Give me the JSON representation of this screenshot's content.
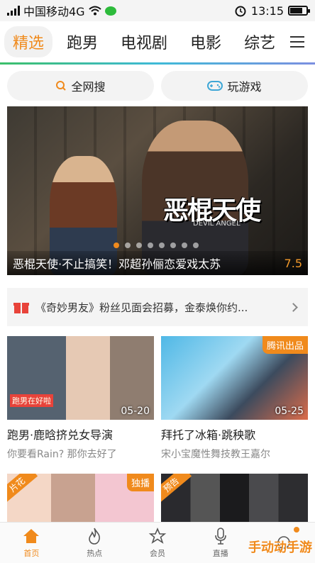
{
  "status_bar": {
    "carrier": "中国移动4G",
    "time": "13:15"
  },
  "tabs": [
    {
      "label": "精选",
      "active": true
    },
    {
      "label": "跑男",
      "active": false
    },
    {
      "label": "电视剧",
      "active": false
    },
    {
      "label": "电影",
      "active": false
    },
    {
      "label": "综艺",
      "active": false
    }
  ],
  "actions": {
    "search_label": "全网搜",
    "game_label": "玩游戏"
  },
  "banner": {
    "logo_text": "恶棍天使",
    "logo_sub": "DEVIL ANGEL",
    "title": "恶棍天使·不止搞笑！邓超孙俪恋爱戏太苏",
    "score": "7.5"
  },
  "notice": {
    "text": "《奇妙男友》粉丝见面会招募，金泰焕你约..."
  },
  "cards": [
    {
      "title": "跑男·鹿晗挤兑女导演",
      "subtitle": "你要看Rain? 那你去好了",
      "date": "05-20",
      "badge": "",
      "thumb_label": "跑男在好啦"
    },
    {
      "title": "拜托了冰箱·跳秧歌",
      "subtitle": "宋小宝魔性舞技教王嘉尔",
      "date": "05-25",
      "badge": "腾讯出品",
      "thumb_label": ""
    },
    {
      "title": "",
      "subtitle": "",
      "date": "",
      "badge": "独播",
      "ribbon": "片花"
    },
    {
      "title": "",
      "subtitle": "",
      "date": "",
      "badge": "",
      "ribbon": "预告"
    }
  ],
  "bottom_nav": [
    {
      "label": "首页",
      "icon": "home-icon",
      "active": true
    },
    {
      "label": "热点",
      "icon": "flame-icon",
      "active": false
    },
    {
      "label": "会员",
      "icon": "star-crown-icon",
      "active": false
    },
    {
      "label": "直播",
      "icon": "microphone-icon",
      "active": false
    },
    {
      "label": "",
      "icon": "chat-icon",
      "active": false
    }
  ],
  "watermark": "手动动手游",
  "colors": {
    "accent": "#f08a1c",
    "notice_icon": "#e8433a"
  }
}
